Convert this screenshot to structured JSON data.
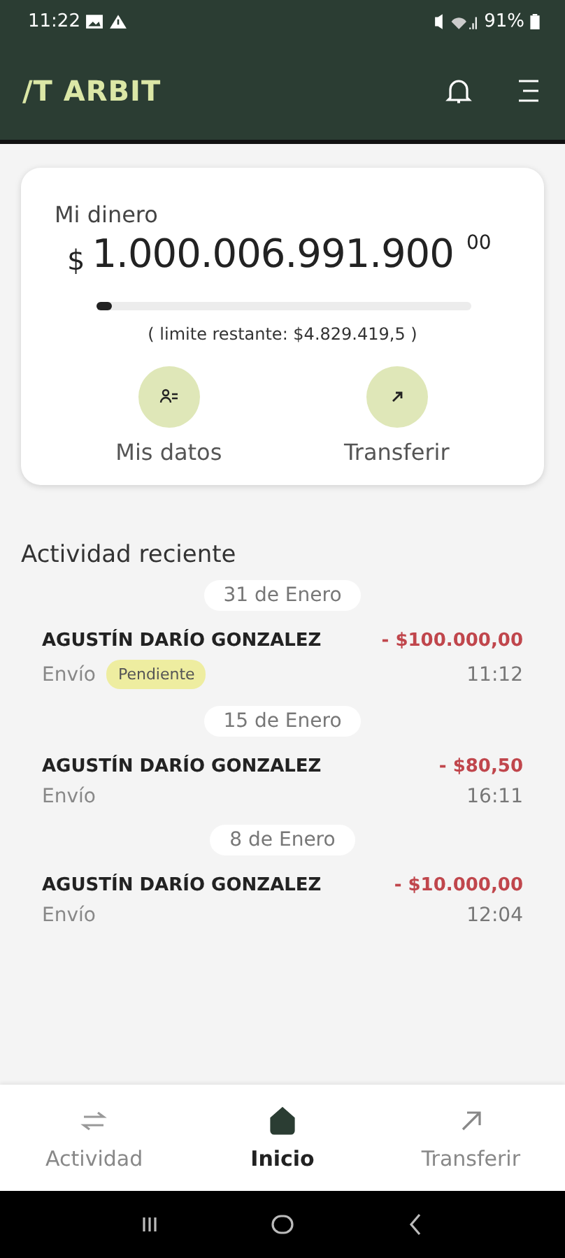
{
  "status_bar": {
    "time": "11:22",
    "battery": "91%"
  },
  "app_bar": {
    "logo": "/T ARBIT"
  },
  "balance_card": {
    "title": "Mi dinero",
    "currency": "$",
    "amount": "1.000.006.991.900",
    "cents": "00",
    "level": 0.01,
    "limit": "( limite restante: $4.829.419,5 )",
    "actions": [
      {
        "kind": "profile",
        "label": "Mis datos"
      },
      {
        "kind": "transfer",
        "label": "Transferir"
      }
    ]
  },
  "activity": {
    "title": "Actividad reciente",
    "groups": [
      {
        "date": "31 de Enero",
        "items": [
          {
            "name": "AGUSTÍN DARÍO GONZALEZ",
            "amount": "- $100.000,00",
            "type": "Envío",
            "badge": "Pendiente",
            "time": "11:12"
          }
        ]
      },
      {
        "date": "15 de Enero",
        "items": [
          {
            "name": "AGUSTÍN DARÍO GONZALEZ",
            "amount": "- $80,50",
            "type": "Envío",
            "time": "16:11"
          }
        ]
      },
      {
        "date": "8 de Enero",
        "items": [
          {
            "name": "AGUSTÍN DARÍO GONZALEZ",
            "amount": "- $10.000,00",
            "type": "Envío",
            "time": "12:04"
          }
        ]
      }
    ]
  },
  "bottom_nav": [
    {
      "kind": "activity",
      "label": "Actividad",
      "selected": false
    },
    {
      "kind": "home",
      "label": "Inicio",
      "selected": true
    },
    {
      "kind": "transfer",
      "label": "Transferir",
      "selected": false
    }
  ]
}
